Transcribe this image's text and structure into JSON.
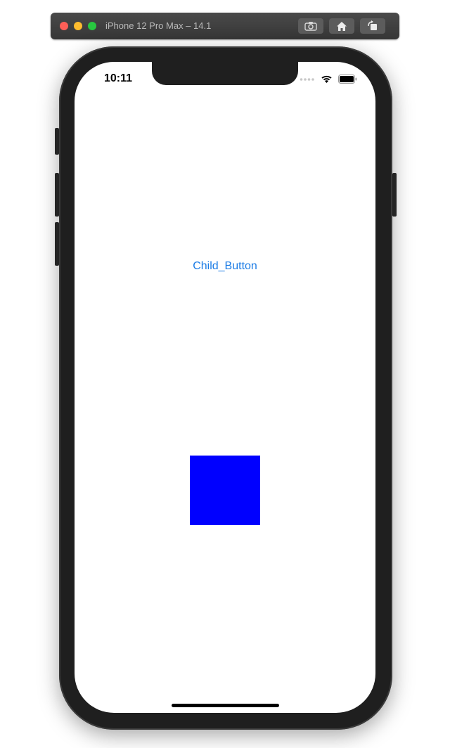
{
  "simulator": {
    "title": "iPhone 12 Pro Max – 14.1",
    "buttons": [
      {
        "name": "screenshot",
        "icon": "camera-icon"
      },
      {
        "name": "home",
        "icon": "home-icon"
      },
      {
        "name": "rotate",
        "icon": "rotate-icon"
      }
    ]
  },
  "status_bar": {
    "time": "10:11",
    "icons": [
      "signal-dots-icon",
      "wifi-icon",
      "battery-icon"
    ]
  },
  "app": {
    "button_label": "Child_Button",
    "button_color": "#1a7be5",
    "square_color": "#0000ff"
  }
}
